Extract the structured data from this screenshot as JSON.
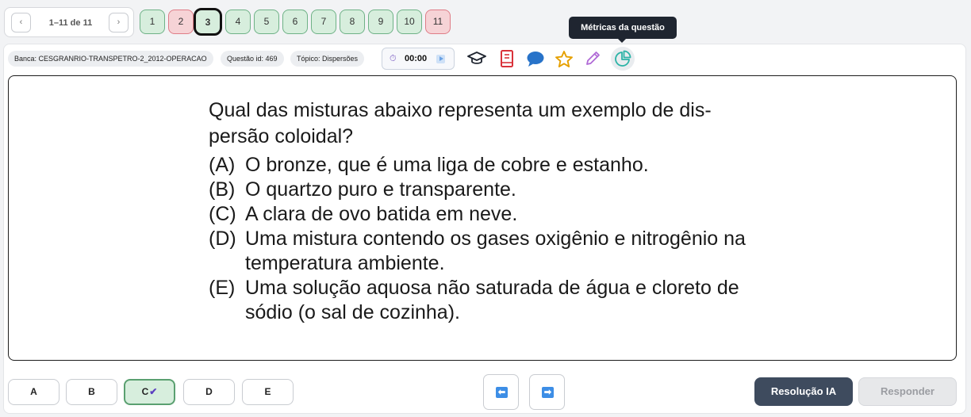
{
  "pager": {
    "prev": "‹",
    "next": "›",
    "count": "1–11 de 11"
  },
  "questions": [
    {
      "num": "1",
      "status": "ok"
    },
    {
      "num": "2",
      "status": "bad"
    },
    {
      "num": "3",
      "status": "current"
    },
    {
      "num": "4",
      "status": "ok"
    },
    {
      "num": "5",
      "status": "ok"
    },
    {
      "num": "6",
      "status": "ok"
    },
    {
      "num": "7",
      "status": "ok"
    },
    {
      "num": "8",
      "status": "ok"
    },
    {
      "num": "9",
      "status": "ok"
    },
    {
      "num": "10",
      "status": "ok"
    },
    {
      "num": "11",
      "status": "bad"
    }
  ],
  "tooltip": "Métricas da questão",
  "meta": {
    "banca": "Banca: CESGRANRIO-TRANSPETRO-2_2012-OPERACAO",
    "questao_id": "Questão id: 469",
    "topico": "Tópico: Dispersões"
  },
  "timer": {
    "time": "00:00"
  },
  "tools": [
    {
      "name": "graduation-cap-icon",
      "color": "#1f2530"
    },
    {
      "name": "book-icon",
      "color": "#d9323a"
    },
    {
      "name": "comment-icon",
      "color": "#2873c9"
    },
    {
      "name": "star-icon",
      "color": "#e6a000"
    },
    {
      "name": "pencil-icon",
      "color": "#b06ad6"
    },
    {
      "name": "pie-chart-icon",
      "color": "#2bb3a6"
    }
  ],
  "question": {
    "stem_line1": "Qual das misturas abaixo representa um exemplo de dis-",
    "stem_line2": "persão coloidal?",
    "options": [
      {
        "letter": "(A)",
        "text": "O bronze, que é uma liga de cobre e estanho."
      },
      {
        "letter": "(B)",
        "text": "O quartzo puro e transparente."
      },
      {
        "letter": "(C)",
        "text": "A clara de ovo batida em neve."
      },
      {
        "letter": "(D)",
        "text": "Uma mistura contendo os gases oxigênio e nitrogênio na temperatura ambiente."
      },
      {
        "letter": "(E)",
        "text": "Uma solução aquosa não saturada de água e cloreto de sódio (o sal de cozinha)."
      }
    ]
  },
  "answers": {
    "a": "A",
    "b": "B",
    "c": "C",
    "d": "D",
    "e": "E",
    "selected": "C",
    "check": "✔"
  },
  "nav": {
    "prev": "⬅",
    "next": "➡"
  },
  "actions": {
    "resolucao": "Resolução IA",
    "responder": "Responder"
  },
  "colors": {
    "accent_dark": "#3e4b5e",
    "ok_fill": "#d7eedd",
    "bad_fill": "#f6d3d6"
  }
}
